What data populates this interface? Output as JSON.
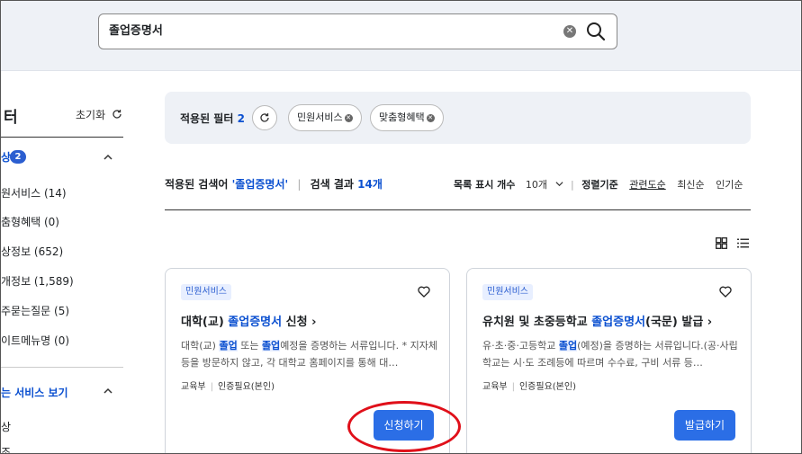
{
  "search": {
    "query": "졸업증명서",
    "icons": {
      "clear": "close-circle-icon",
      "search": "magnifier-icon"
    }
  },
  "sidebar": {
    "title": "터",
    "reset_label": "초기화",
    "category": {
      "label": "상",
      "count": "2"
    },
    "items": [
      {
        "label": "원서비스 (14)"
      },
      {
        "label": "춤형혜택 (0)"
      },
      {
        "label": "상정보 (652)"
      },
      {
        "label": "개정보 (1,589)"
      },
      {
        "label": "주묻는질문 (5)"
      },
      {
        "label": "이트메뉴명 (0)"
      }
    ],
    "other_services_label": "는 서비스 보기",
    "other_item_label": "상",
    "other_item_label2": "조"
  },
  "filter_bar": {
    "label": "적용된 필터",
    "count": "2",
    "chips": [
      {
        "label": "민원서비스"
      },
      {
        "label": "맞춤형혜택"
      }
    ]
  },
  "results": {
    "applied_query_label": "적용된 검색어",
    "applied_query": "'졸업증명서'",
    "result_label": "검색 결과",
    "result_count": "14개",
    "list_count_label": "목록 표시 개수",
    "list_count_value": "10개",
    "sort_label": "정렬기준",
    "sort_options": [
      "관련도순",
      "최신순",
      "인기순"
    ],
    "active_sort": "관련도순"
  },
  "cards": [
    {
      "tag": "민원서비스",
      "title_pre": "대학(교) ",
      "title_hl": "졸업증명서",
      "title_post": " 신청 ›",
      "desc_1": "대학(교) ",
      "desc_hl1": "졸업",
      "desc_2": " 또는 ",
      "desc_hl2": "졸업",
      "desc_3": "예정을 증명하는 서류입니다. * 지자체 등을 방문하지 않고, 각 대학교 홈페이지를 통해 대…",
      "dept": "교육부",
      "auth": "인증필요(본인)",
      "button": "신청하기"
    },
    {
      "tag": "민원서비스",
      "title_pre": "유치원 및 초중등학교 ",
      "title_hl": "졸업증명서",
      "title_post": "(국문) 발급 ›",
      "desc_1": "유·초·중·고등학교 ",
      "desc_hl1": "졸업",
      "desc_2": "(예정)을 증명하는 서류입니다.(공·사립학교는 시·도 조례등에 따르며 수수료, 구비 서류 등…",
      "desc_hl2": "",
      "desc_3": "",
      "dept": "교육부",
      "auth": "인증필요(본인)",
      "button": "발급하기"
    }
  ],
  "colors": {
    "accent": "#2b6ee6",
    "highlight_text": "#0b50d0",
    "annotation": "#e0101a",
    "band_bg": "#eef1f6"
  }
}
